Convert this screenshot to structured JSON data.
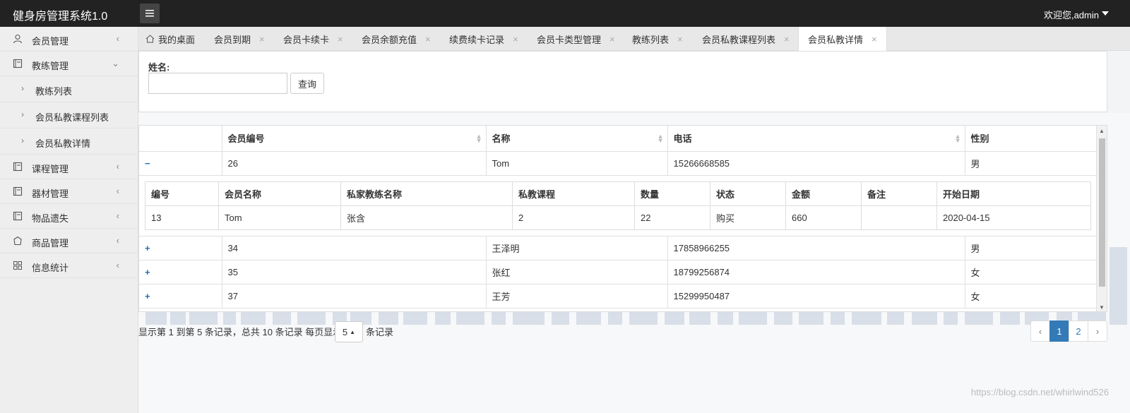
{
  "header": {
    "app_title": "健身房管理系统1.0",
    "welcome": "欢迎您,admin"
  },
  "sidebar": {
    "items": [
      {
        "label": "会员管理",
        "icon": "user-icon"
      },
      {
        "label": "教练管理",
        "icon": "book-icon"
      },
      {
        "label": "课程管理",
        "icon": "book-icon"
      },
      {
        "label": "器材管理",
        "icon": "book-icon"
      },
      {
        "label": "物品遗失",
        "icon": "book-icon"
      },
      {
        "label": "商品管理",
        "icon": "bag-icon"
      },
      {
        "label": "信息统计",
        "icon": "grid-icon"
      }
    ],
    "sub_items": [
      "教练列表",
      "会员私教课程列表",
      "会员私教详情"
    ]
  },
  "tabs": [
    {
      "label": "我的桌面"
    },
    {
      "label": "会员到期"
    },
    {
      "label": "会员卡续卡"
    },
    {
      "label": "会员余额充值"
    },
    {
      "label": "续费续卡记录"
    },
    {
      "label": "会员卡类型管理"
    },
    {
      "label": "教练列表"
    },
    {
      "label": "会员私教课程列表"
    },
    {
      "label": "会员私教详情"
    }
  ],
  "search": {
    "label": "姓名:",
    "value": "",
    "placeholder": "",
    "button": "查询"
  },
  "table": {
    "columns": [
      "会员编号",
      "名称",
      "电话",
      "性别"
    ],
    "rows": [
      {
        "id": "26",
        "name": "Tom",
        "phone": "15266668585",
        "gender": "男",
        "expanded": true
      },
      {
        "id": "34",
        "name": "王泽明",
        "phone": "17858966255",
        "gender": "男",
        "expanded": false
      },
      {
        "id": "35",
        "name": "张红",
        "phone": "18799256874",
        "gender": "女",
        "expanded": false
      },
      {
        "id": "37",
        "name": "王芳",
        "phone": "15299950487",
        "gender": "女",
        "expanded": false
      }
    ],
    "detail": {
      "columns": [
        "编号",
        "会员名称",
        "私家教练名称",
        "私教课程",
        "数量",
        "状态",
        "金额",
        "备注",
        "开始日期"
      ],
      "row": [
        "13",
        "Tom",
        "张含",
        "2",
        "22",
        "购买",
        "660",
        "",
        "2020-04-15"
      ]
    }
  },
  "pagination": {
    "info": "显示第 1 到第 5 条记录，总共 10 条记录 每页显示",
    "per_page": "5",
    "suffix": "条记录",
    "prev": "‹",
    "pages": [
      "1",
      "2"
    ],
    "next": "›",
    "active_page": "1"
  },
  "watermark": "https://blog.csdn.net/whirlwind526"
}
